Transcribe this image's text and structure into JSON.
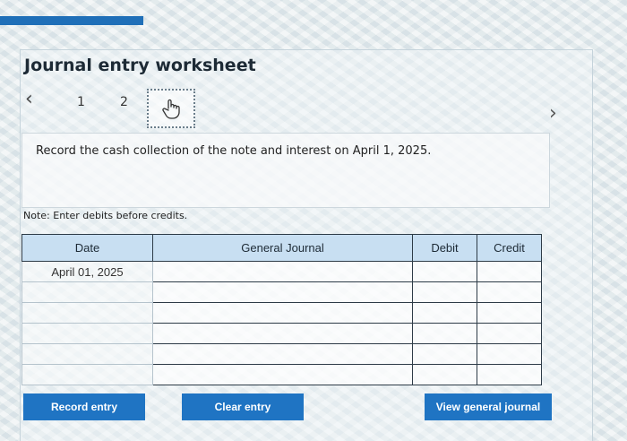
{
  "header": {
    "title": "Journal entry worksheet"
  },
  "nav": {
    "prev_icon": "chevron-left-icon",
    "next_icon": "chevron-right-icon",
    "steps": [
      {
        "label": "1"
      },
      {
        "label": "2"
      },
      {
        "icon": "hand-pointer-icon",
        "active": true
      }
    ]
  },
  "instruction": {
    "text": "Record the cash collection of the note and interest on April 1, 2025."
  },
  "note": {
    "text": "Note: Enter debits before credits."
  },
  "table": {
    "headers": [
      "Date",
      "General Journal",
      "Debit",
      "Credit"
    ],
    "rows": [
      {
        "date": "April 01, 2025",
        "account": "",
        "debit": "",
        "credit": ""
      },
      {
        "date": "",
        "account": "",
        "debit": "",
        "credit": ""
      },
      {
        "date": "",
        "account": "",
        "debit": "",
        "credit": ""
      },
      {
        "date": "",
        "account": "",
        "debit": "",
        "credit": ""
      },
      {
        "date": "",
        "account": "",
        "debit": "",
        "credit": ""
      },
      {
        "date": "",
        "account": "",
        "debit": "",
        "credit": ""
      }
    ]
  },
  "buttons": {
    "record": "Record entry",
    "clear": "Clear entry",
    "view": "View general journal"
  },
  "colors": {
    "accent": "#1f74c3",
    "header_bg": "#c8dff2"
  }
}
